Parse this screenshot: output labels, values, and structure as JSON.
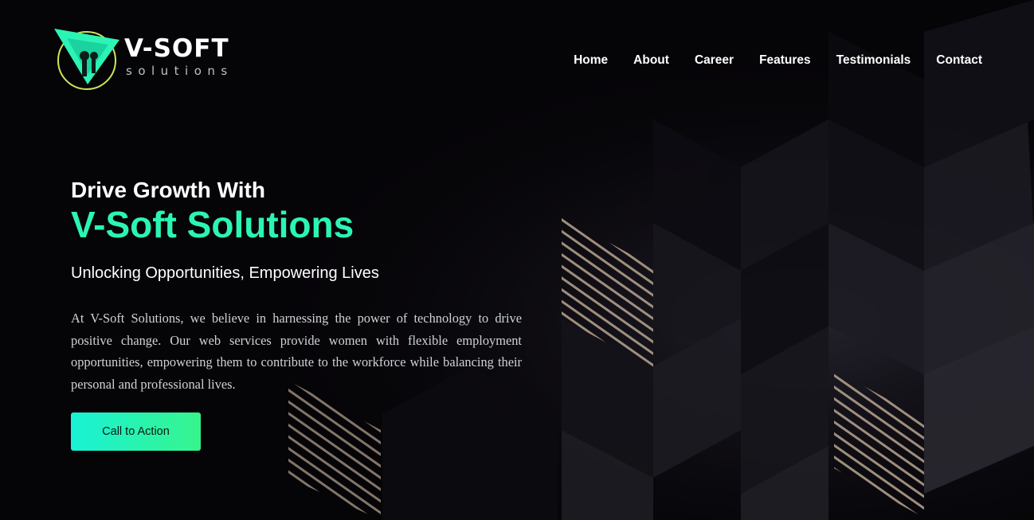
{
  "brand": {
    "name": "V-SOFT",
    "subtitle": "solutions",
    "accent_color": "#2bf5b4",
    "ring_color": "#c9e85a",
    "icon": "v-triangle-logo-icon"
  },
  "nav": {
    "items": [
      {
        "label": "Home"
      },
      {
        "label": "About"
      },
      {
        "label": "Career"
      },
      {
        "label": "Features"
      },
      {
        "label": "Testimonials"
      },
      {
        "label": "Contact"
      }
    ]
  },
  "hero": {
    "heading_line1": "Drive Growth With",
    "heading_line2": "V-Soft Solutions",
    "tagline": "Unlocking Opportunities, Empowering Lives",
    "description": "At V-Soft Solutions, we believe in harnessing the power of technology to drive positive change. Our web services provide women with flexible employment opportunities, empowering them to contribute to the workforce while balancing their personal and professional lives.",
    "cta_label": "Call to Action",
    "cta_gradient": [
      "#19f2d6",
      "#37f48c"
    ]
  },
  "background": {
    "pattern": "dark-isometric-cubes",
    "stripe_color": "#b8a592"
  }
}
